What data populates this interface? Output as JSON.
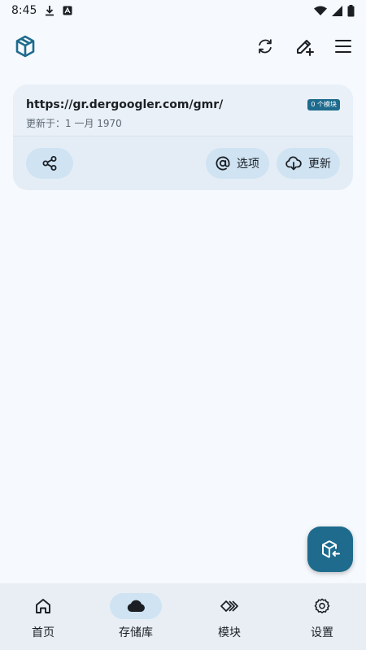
{
  "status_bar": {
    "time": "8:45"
  },
  "top_bar": {
    "actions": [
      "refresh-icon",
      "edit-add-icon",
      "menu-icon"
    ]
  },
  "repo": {
    "url": "https://gr.dergoogler.com/gmr/",
    "updated": "更新于：1 一月 1970",
    "badge": "0 个模块",
    "options_label": "选项",
    "update_label": "更新"
  },
  "bottom_nav": {
    "items": [
      {
        "label": "首页",
        "icon": "home-icon"
      },
      {
        "label": "存储库",
        "icon": "cloud-icon"
      },
      {
        "label": "模块",
        "icon": "modules-icon"
      },
      {
        "label": "设置",
        "icon": "gear-icon"
      }
    ],
    "active": "存储库"
  },
  "colors": {
    "accent": "#1e6b8d",
    "pill": "#cfe3f3",
    "background": "#f6f9fd"
  }
}
